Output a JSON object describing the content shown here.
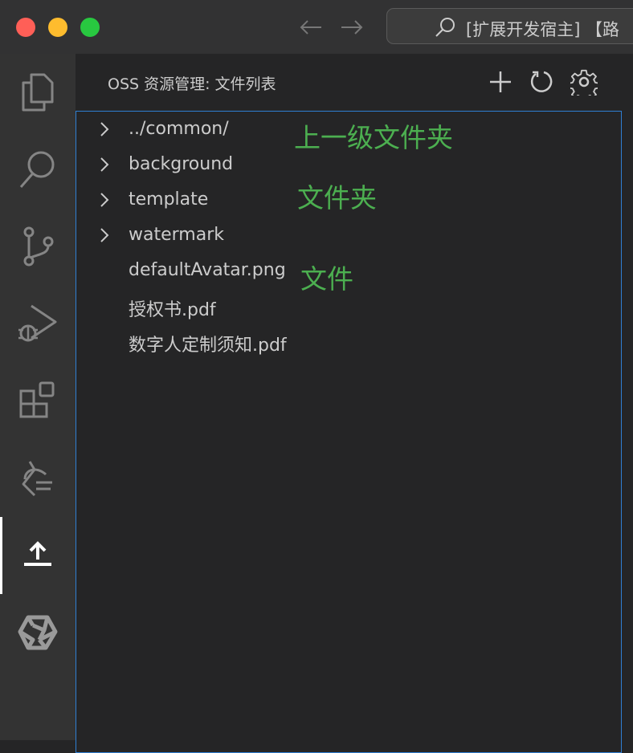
{
  "titlebar": {
    "command_center_text": "[扩展开发宿主] 【路"
  },
  "sidebar": {
    "title": "OSS 资源管理: 文件列表"
  },
  "tree": {
    "items": [
      {
        "label": "../common/",
        "kind": "folder"
      },
      {
        "label": "background",
        "kind": "folder"
      },
      {
        "label": "template",
        "kind": "folder"
      },
      {
        "label": "watermark",
        "kind": "folder"
      },
      {
        "label": "defaultAvatar.png",
        "kind": "file"
      },
      {
        "label": "授权书.pdf",
        "kind": "file"
      },
      {
        "label": "数字人定制须知.pdf",
        "kind": "file"
      }
    ]
  },
  "annotations": {
    "parent_folder": "上一级文件夹",
    "folder": "文件夹",
    "file": "文件"
  },
  "activity_bar": {
    "icons": [
      "explorer-icon",
      "search-icon",
      "source-control-icon",
      "run-debug-icon",
      "extensions-icon",
      "remote-icon",
      "upload-icon",
      "openai-icon"
    ],
    "active": "upload-icon"
  },
  "colors": {
    "accent_border": "#2f7fd3",
    "annotation_green": "#4caf50"
  }
}
